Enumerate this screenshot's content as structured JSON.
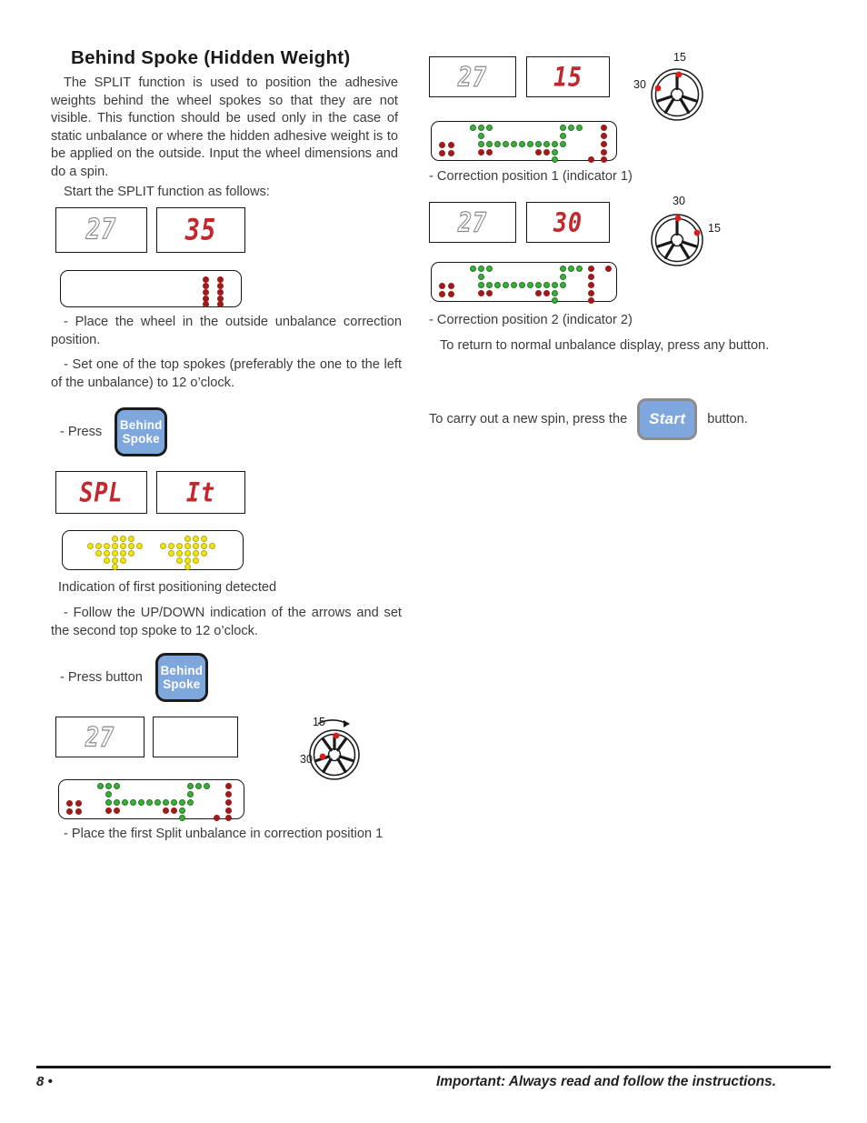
{
  "document": {
    "title": "Behind Spoke (Hidden Weight)",
    "footer": {
      "page_number": "8 •",
      "notice": "Important: Always read and follow the instructions."
    }
  },
  "colors": {
    "led_red": "#9e1b1b",
    "led_green": "#3eac3e",
    "led_yellow": "#f2e515",
    "segment_red": "#c1272d",
    "button_blue": "#7da7dd",
    "wheel_marker_red": "#e01b1b"
  },
  "left_column": {
    "intro": "The SPLIT function is used to position the adhesive weights behind the wheel spokes so that they are not visible. This function should be used only in the case of static unbalance or where the hidden adhesive weight is to be applied on the outside. Input the wheel dimensions and do a spin.",
    "start_instruction": "Start the SPLIT function as follows:",
    "display_1": {
      "left_value": "27",
      "left_state": "off",
      "right_value": "35",
      "right_state": "on"
    },
    "step_place_wheel": "- Place the wheel in the outside unbalance correction position.",
    "step_set_spoke": "- Set one of the top spokes (preferably the one to the left of the unbalance) to 12 o’clock.",
    "press_label": "- Press",
    "behind_spoke_button": {
      "line1": "Behind",
      "line2": "Spoke"
    },
    "display_2": {
      "left_value": "SPL",
      "left_state": "on",
      "right_value": "It",
      "right_state": "on"
    },
    "first_positioning_caption": "Indication of first positioning detected",
    "step_follow_arrows": "- Follow the UP/DOWN indication of the arrows and set the second top spoke to 12 o’clock.",
    "press_button_label": "- Press button",
    "display_3": {
      "left_value": "27",
      "left_state": "off",
      "right_value": "",
      "right_state": "blank"
    },
    "wheel_1": {
      "label_top_left": "15",
      "label_left": "30",
      "rotation_arrow": true
    },
    "step_place_split": "- Place the first Split unbalance in correction position 1"
  },
  "right_column": {
    "display_4": {
      "left_value": "27",
      "left_state": "off",
      "right_value": "15",
      "right_state": "on"
    },
    "wheel_2": {
      "label_top": "15",
      "label_left": "30"
    },
    "caption_1": "- Correction position 1 (indicator 1)",
    "display_5": {
      "left_value": "27",
      "left_state": "off",
      "right_value": "30",
      "right_state": "on"
    },
    "wheel_3": {
      "label_top": "30",
      "label_right": "15"
    },
    "caption_2": "- Correction position 2 (indicator 2)",
    "return_text": "To return to normal unbalance display, press any button.",
    "new_spin_prefix": "To carry out a new spin, press the",
    "new_spin_suffix": "button.",
    "start_button": {
      "label": "Start"
    }
  }
}
